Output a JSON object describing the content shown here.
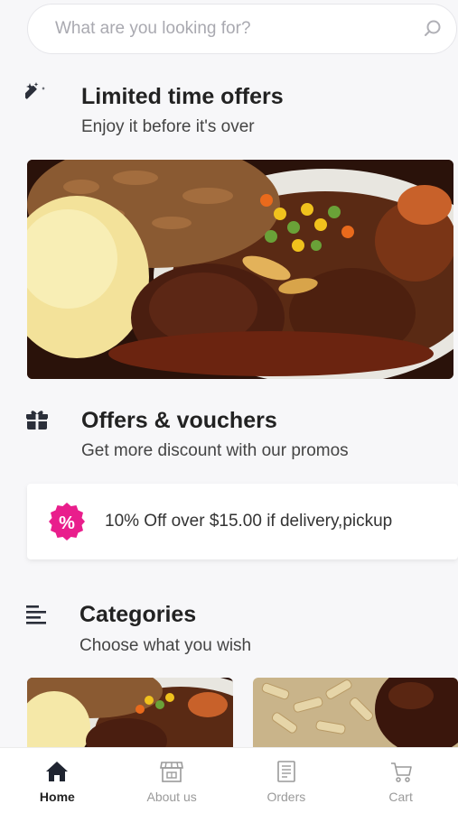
{
  "search": {
    "placeholder": "What are you looking for?"
  },
  "sections": {
    "limited": {
      "title": "Limited time offers",
      "subtitle": "Enjoy it before it's over"
    },
    "offers": {
      "title": "Offers & vouchers",
      "subtitle": "Get more discount with our promos"
    },
    "categories": {
      "title": "Categories",
      "subtitle": "Choose what you wish"
    }
  },
  "voucher": {
    "text": "10% Off over $15.00 if delivery,pickup",
    "badge_symbol": "%",
    "badge_color": "#e91e8c"
  },
  "nav": {
    "items": [
      {
        "label": "Home",
        "icon": "home-icon",
        "active": true
      },
      {
        "label": "About us",
        "icon": "store-icon",
        "active": false
      },
      {
        "label": "Orders",
        "icon": "orders-icon",
        "active": false
      },
      {
        "label": "Cart",
        "icon": "cart-icon",
        "active": false
      }
    ]
  },
  "colors": {
    "accent": "#e91e8c",
    "text_primary": "#222222",
    "text_muted": "#9a9a9a"
  }
}
